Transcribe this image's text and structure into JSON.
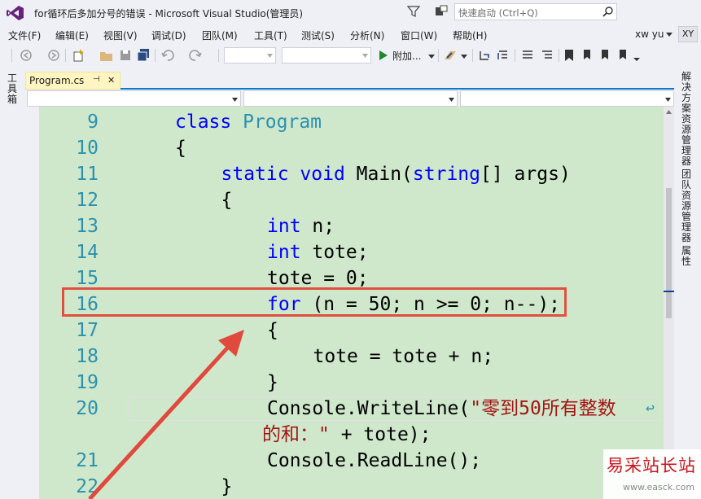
{
  "window": {
    "title": "for循环后多加分号的错误 - Microsoft Visual Studio(管理员)",
    "quick_launch_placeholder": "快速启动 (Ctrl+Q)",
    "user": "xw yu",
    "avatar": "XY"
  },
  "menu": [
    "文件(F)",
    "编辑(E)",
    "视图(V)",
    "调试(D)",
    "团队(M)",
    "工具(T)",
    "测试(S)",
    "分析(N)",
    "窗口(W)",
    "帮助(H)"
  ],
  "toolbar": {
    "run_label": "附加..."
  },
  "left_panel": {
    "toolbox_label": "工具箱"
  },
  "right_panel": {
    "tabs": [
      "解决方案资源管理器",
      "团队资源管理器",
      "属性"
    ]
  },
  "doc_tab": {
    "name": "Program.cs",
    "pin": "⊣",
    "close": "✕"
  },
  "code_lines": [
    {
      "num": "9",
      "indent": 0,
      "tokens": [
        [
          "kw",
          "class "
        ],
        [
          "ty",
          "Program"
        ]
      ]
    },
    {
      "num": "10",
      "indent": 0,
      "tokens": [
        [
          "plain",
          "{"
        ]
      ]
    },
    {
      "num": "11",
      "indent": 1,
      "tokens": [
        [
          "kw",
          "static void "
        ],
        [
          "plain",
          "Main("
        ],
        [
          "kw",
          "string"
        ],
        [
          "plain",
          "[] args)"
        ]
      ]
    },
    {
      "num": "12",
      "indent": 1,
      "tokens": [
        [
          "plain",
          "{"
        ]
      ]
    },
    {
      "num": "13",
      "indent": 2,
      "tokens": [
        [
          "kw",
          "int "
        ],
        [
          "plain",
          "n;"
        ]
      ]
    },
    {
      "num": "14",
      "indent": 2,
      "tokens": [
        [
          "kw",
          "int "
        ],
        [
          "plain",
          "tote;"
        ]
      ]
    },
    {
      "num": "15",
      "indent": 2,
      "tokens": [
        [
          "plain",
          "tote = 0;"
        ]
      ]
    },
    {
      "num": "16",
      "indent": 2,
      "tokens": [
        [
          "kw",
          "for "
        ],
        [
          "plain",
          "(n = 50; n >= 0; n--);"
        ]
      ]
    },
    {
      "num": "17",
      "indent": 2,
      "tokens": [
        [
          "plain",
          "{"
        ]
      ]
    },
    {
      "num": "18",
      "indent": 3,
      "tokens": [
        [
          "plain",
          "tote = tote + n;"
        ]
      ]
    },
    {
      "num": "19",
      "indent": 2,
      "tokens": [
        [
          "plain",
          "}"
        ]
      ]
    },
    {
      "num": "20",
      "indent": 2,
      "tokens": [
        [
          "plain",
          "Console.WriteLine("
        ],
        [
          "str",
          "\"零到50所有整数"
        ]
      ]
    },
    {
      "num": "",
      "indent": 2,
      "tokens": [
        [
          "str",
          "的和：\""
        ],
        [
          "plain",
          " + tote);"
        ]
      ],
      "wrap": true
    },
    {
      "num": "21",
      "indent": 2,
      "tokens": [
        [
          "plain",
          "Console.ReadLine();"
        ]
      ]
    },
    {
      "num": "22",
      "indent": 1,
      "tokens": [
        [
          "plain",
          "}"
        ]
      ]
    }
  ],
  "watermark": {
    "main": "易采站长站",
    "sub": "www.easck.com"
  }
}
